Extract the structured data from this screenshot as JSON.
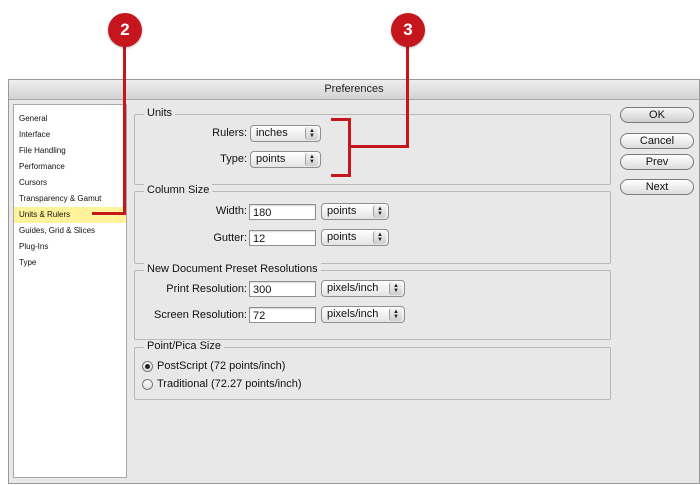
{
  "callouts": {
    "left": "2",
    "right": "3"
  },
  "window": {
    "title": "Preferences"
  },
  "sidebar": {
    "items": [
      "General",
      "Interface",
      "File Handling",
      "Performance",
      "Cursors",
      "Transparency & Gamut",
      "Units & Rulers",
      "Guides, Grid & Slices",
      "Plug-Ins",
      "Type"
    ],
    "selected": "Units & Rulers"
  },
  "units": {
    "legend": "Units",
    "rulers_label": "Rulers:",
    "rulers_value": "inches",
    "type_label": "Type:",
    "type_value": "points"
  },
  "column_size": {
    "legend": "Column Size",
    "width_label": "Width:",
    "width_value": "180",
    "width_unit": "points",
    "gutter_label": "Gutter:",
    "gutter_value": "12",
    "gutter_unit": "points"
  },
  "resolutions": {
    "legend": "New Document Preset Resolutions",
    "print_label": "Print Resolution:",
    "print_value": "300",
    "print_unit": "pixels/inch",
    "screen_label": "Screen Resolution:",
    "screen_value": "72",
    "screen_unit": "pixels/inch"
  },
  "point_size": {
    "legend": "Point/Pica Size",
    "postscript_label": "PostScript (72 points/inch)",
    "traditional_label": "Traditional (72.27 points/inch)",
    "selected": "PostScript (72 points/inch)"
  },
  "buttons": {
    "ok": "OK",
    "cancel": "Cancel",
    "prev": "Prev",
    "next": "Next"
  },
  "colors": {
    "callout": "#c4161c",
    "selection": "#fff29a"
  }
}
